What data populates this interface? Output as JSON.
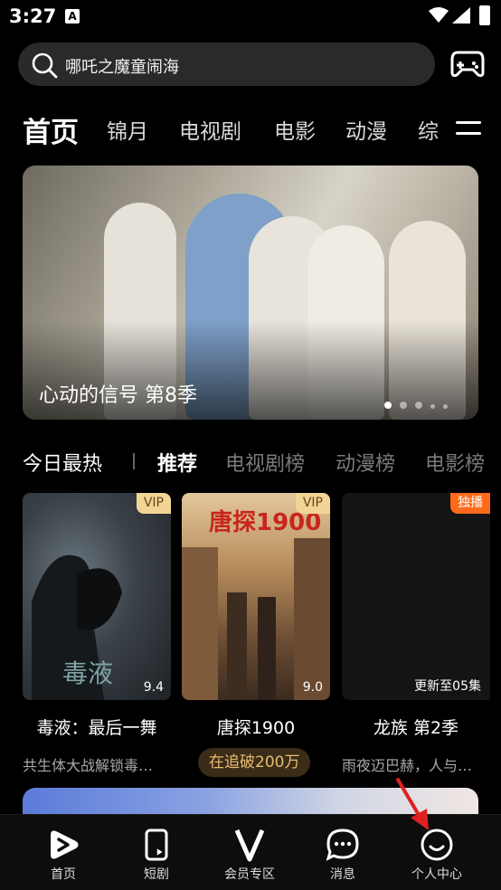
{
  "status_bar": {
    "time": "3:27",
    "notification_icon": "A"
  },
  "search": {
    "placeholder_text": "哪吒之魔童闹海"
  },
  "top_tabs": [
    "首页",
    "锦月",
    "电视剧",
    "电影",
    "动漫",
    "综"
  ],
  "banner": {
    "title": "心动的信号 第8季",
    "page_indicator_count": 5,
    "active_index": 0
  },
  "rank_tabs": {
    "hot_label": "今日最热",
    "items": [
      "推荐",
      "电视剧榜",
      "动漫榜",
      "电影榜"
    ],
    "active_index": 0
  },
  "cards": [
    {
      "badge": "VIP",
      "badge_type": "vip",
      "score": "9.4",
      "title": "毒液：最后一舞",
      "desc": "共生体大战解锁毒…",
      "poster_text": "毒液"
    },
    {
      "badge": "VIP",
      "badge_type": "vip",
      "score": "9.0",
      "title": "唐探1900",
      "pill": "在追破200万",
      "poster_text": "唐探1900"
    },
    {
      "badge": "独播",
      "badge_type": "exclusive",
      "update": "更新至05集",
      "title": "龙族 第2季",
      "desc": "雨夜迈巴赫，人与…"
    }
  ],
  "bottom_nav": [
    {
      "label": "首页",
      "icon": "home-play-icon"
    },
    {
      "label": "短剧",
      "icon": "short-video-icon"
    },
    {
      "label": "会员专区",
      "icon": "vip-v-icon"
    },
    {
      "label": "消息",
      "icon": "message-icon"
    },
    {
      "label": "个人中心",
      "icon": "profile-smile-icon"
    }
  ],
  "colors": {
    "vip_badge": "#f2d595",
    "exclusive_badge": "#ff6a1a",
    "pill_text": "#e7bd71",
    "annotation_arrow": "#e02020"
  }
}
